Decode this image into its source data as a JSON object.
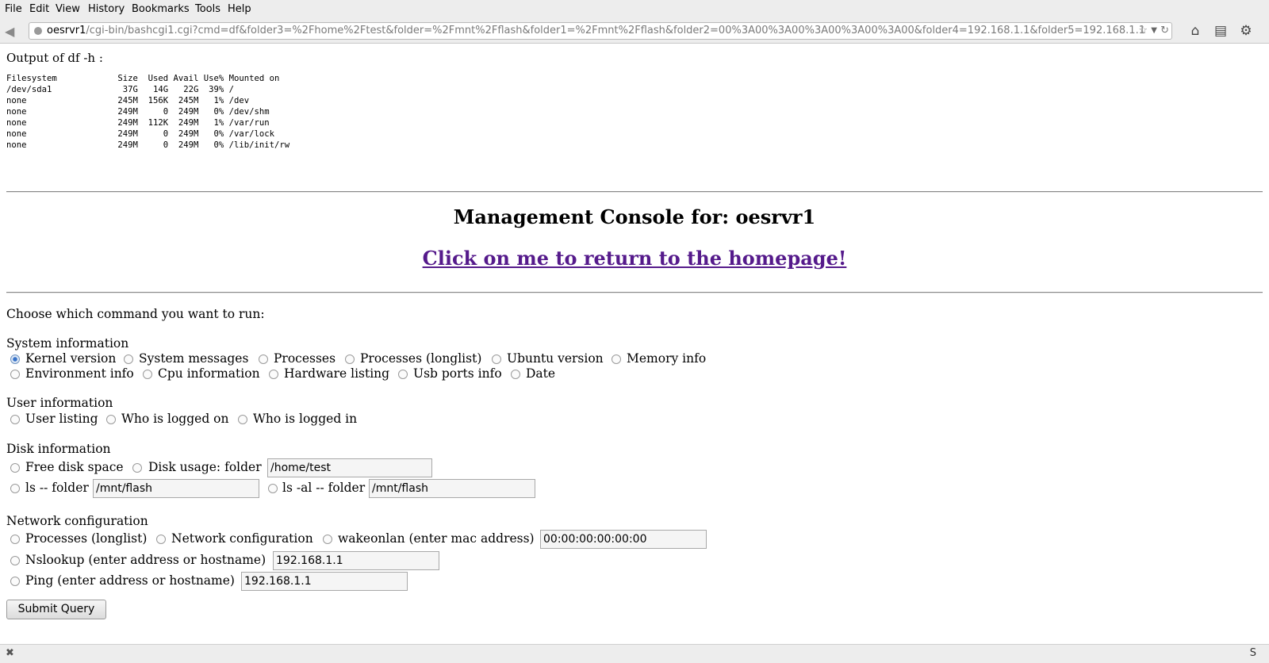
{
  "browser": {
    "menu": [
      "File",
      "Edit",
      "View",
      "History",
      "Bookmarks",
      "Tools",
      "Help"
    ],
    "url_host": "oesrvr1",
    "url_rest": "/cgi-bin/bashcgi1.cgi?cmd=df&folder3=%2Fhome%2Ftest&folder=%2Fmnt%2Fflash&folder1=%2Fmnt%2Fflash&folder2=00%3A00%3A00%3A00%3A00%3A00&folder4=192.168.1.1&folder5=192.168.1.1"
  },
  "output": {
    "title": "Output of df -h :",
    "df_text": "Filesystem            Size  Used Avail Use% Mounted on\n/dev/sda1              37G   14G   22G  39% /\nnone                  245M  156K  245M   1% /dev\nnone                  249M     0  249M   0% /dev/shm\nnone                  249M  112K  249M   1% /var/run\nnone                  249M     0  249M   0% /var/lock\nnone                  249M     0  249M   0% /lib/init/rw"
  },
  "header": {
    "title": "Management Console for: oesrvr1",
    "home_link": "Click on me to return to the homepage!"
  },
  "form": {
    "prompt": "Choose which command you want to run:",
    "sections": {
      "system": "System information",
      "user": "User information",
      "disk": "Disk information",
      "network": "Network configuration"
    },
    "system_options": [
      "Kernel version",
      "System messages",
      "Processes",
      "Processes (longlist)",
      "Ubuntu version",
      "Memory info",
      "Environment info",
      "Cpu information",
      "Hardware listing",
      "Usb ports info",
      "Date"
    ],
    "user_options": [
      "User listing",
      "Who is logged on",
      "Who is logged in"
    ],
    "disk_options": [
      "Free disk space",
      "Disk usage: folder",
      "ls -- folder",
      "ls -al -- folder"
    ],
    "network_options": [
      "Processes (longlist)",
      "Network configuration",
      "wakeonlan (enter mac address)",
      "Nslookup (enter address or hostname)",
      "Ping (enter address or hostname)"
    ],
    "fields": {
      "disk_usage_folder": "/home/test",
      "ls_folder": "/mnt/flash",
      "ls_al_folder": "/mnt/flash",
      "mac_address": "00:00:00:00:00:00",
      "nslookup_host": "192.168.1.1",
      "ping_host": "192.168.1.1"
    },
    "selected": "Kernel version",
    "submit_label": "Submit Query"
  },
  "status": {
    "right_glyph": "S"
  }
}
